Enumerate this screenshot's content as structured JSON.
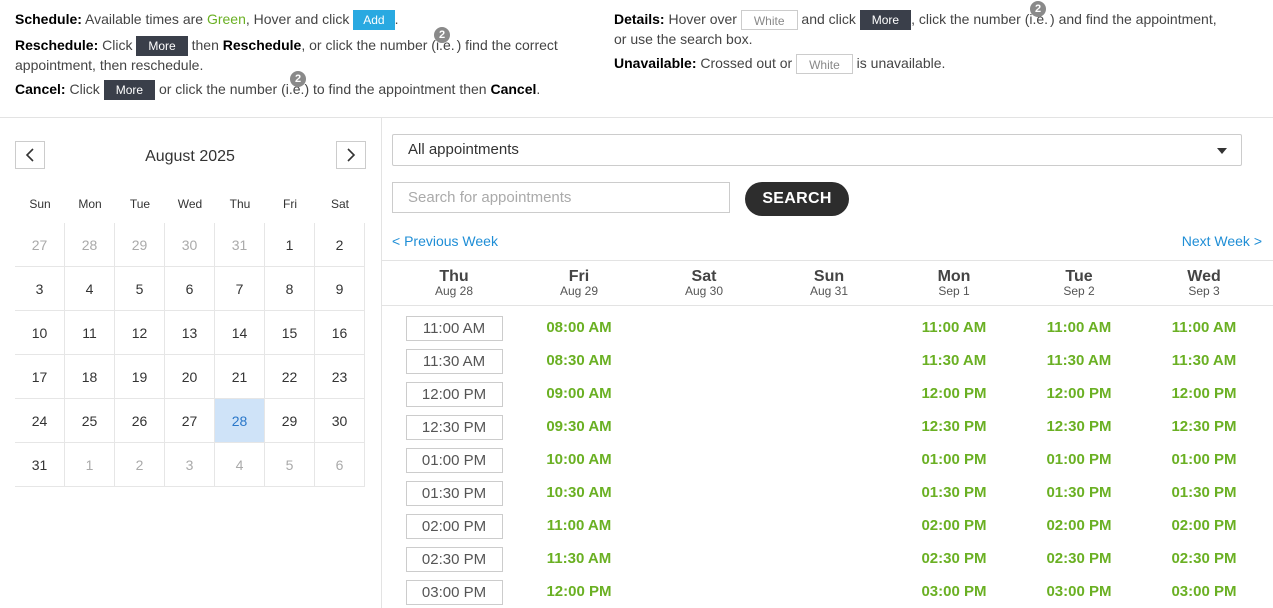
{
  "instructions": {
    "schedule": {
      "label": "Schedule:",
      "t1": "Available times are",
      "green": "Green",
      "t2": ", Hover and click",
      "add": "Add",
      "t3": "."
    },
    "reschedule": {
      "label": "Reschedule:",
      "t1": "Click",
      "more": "More",
      "t2": "then",
      "bold": "Reschedule",
      "t3": ", or click the number (i.e.",
      "badge": "2",
      "t4": ") find the correct",
      "t5": "appointment, then reschedule."
    },
    "cancel": {
      "label": "Cancel:",
      "t1": "Click",
      "more": "More",
      "t2": "or click the number (i.e.",
      "badge": "2",
      "t3": ") to find the appointment then",
      "bold": "Cancel",
      "t4": "."
    },
    "details": {
      "label": "Details:",
      "t1": "Hover over",
      "white": "White",
      "t2": "and click",
      "more": "More",
      "t3": ", click the number (i.e.",
      "badge": "2",
      "t4": ") and find the appointment,",
      "t5": "or use the search box."
    },
    "unavailable": {
      "label": "Unavailable:",
      "t1": "Crossed out or",
      "white": "White",
      "t2": "is unavailable."
    }
  },
  "calendar": {
    "month": "August 2025",
    "dow": [
      "Sun",
      "Mon",
      "Tue",
      "Wed",
      "Thu",
      "Fri",
      "Sat"
    ],
    "weeks": [
      [
        {
          "d": "27",
          "o": true
        },
        {
          "d": "28",
          "o": true
        },
        {
          "d": "29",
          "o": true
        },
        {
          "d": "30",
          "o": true
        },
        {
          "d": "31",
          "o": true
        },
        {
          "d": "1"
        },
        {
          "d": "2"
        }
      ],
      [
        {
          "d": "3"
        },
        {
          "d": "4"
        },
        {
          "d": "5"
        },
        {
          "d": "6"
        },
        {
          "d": "7"
        },
        {
          "d": "8"
        },
        {
          "d": "9"
        }
      ],
      [
        {
          "d": "10"
        },
        {
          "d": "11"
        },
        {
          "d": "12"
        },
        {
          "d": "13"
        },
        {
          "d": "14"
        },
        {
          "d": "15"
        },
        {
          "d": "16"
        }
      ],
      [
        {
          "d": "17"
        },
        {
          "d": "18"
        },
        {
          "d": "19"
        },
        {
          "d": "20"
        },
        {
          "d": "21"
        },
        {
          "d": "22"
        },
        {
          "d": "23"
        }
      ],
      [
        {
          "d": "24"
        },
        {
          "d": "25"
        },
        {
          "d": "26"
        },
        {
          "d": "27"
        },
        {
          "d": "28",
          "sel": true
        },
        {
          "d": "29"
        },
        {
          "d": "30"
        }
      ],
      [
        {
          "d": "31"
        },
        {
          "d": "1",
          "o": true
        },
        {
          "d": "2",
          "o": true
        },
        {
          "d": "3",
          "o": true
        },
        {
          "d": "4",
          "o": true
        },
        {
          "d": "5",
          "o": true
        },
        {
          "d": "6",
          "o": true
        }
      ]
    ]
  },
  "filter": {
    "selected": "All appointments"
  },
  "search": {
    "placeholder": "Search for appointments",
    "button": "SEARCH"
  },
  "nav": {
    "prev": "< Previous Week",
    "next": "Next Week >"
  },
  "days": [
    {
      "name": "Thu",
      "date": "Aug 28",
      "unavailable": true,
      "slots": [
        "11:00 AM",
        "11:30 AM",
        "12:00 PM",
        "12:30 PM",
        "01:00 PM",
        "01:30 PM",
        "02:00 PM",
        "02:30 PM",
        "03:00 PM"
      ]
    },
    {
      "name": "Fri",
      "date": "Aug 29",
      "slots": [
        "08:00 AM",
        "08:30 AM",
        "09:00 AM",
        "09:30 AM",
        "10:00 AM",
        "10:30 AM",
        "11:00 AM",
        "11:30 AM",
        "12:00 PM"
      ]
    },
    {
      "name": "Sat",
      "date": "Aug 30",
      "slots": []
    },
    {
      "name": "Sun",
      "date": "Aug 31",
      "slots": []
    },
    {
      "name": "Mon",
      "date": "Sep 1",
      "slots": [
        "11:00 AM",
        "11:30 AM",
        "12:00 PM",
        "12:30 PM",
        "01:00 PM",
        "01:30 PM",
        "02:00 PM",
        "02:30 PM",
        "03:00 PM"
      ]
    },
    {
      "name": "Tue",
      "date": "Sep 2",
      "slots": [
        "11:00 AM",
        "11:30 AM",
        "12:00 PM",
        "12:30 PM",
        "01:00 PM",
        "01:30 PM",
        "02:00 PM",
        "02:30 PM",
        "03:00 PM"
      ]
    },
    {
      "name": "Wed",
      "date": "Sep 3",
      "slots": [
        "11:00 AM",
        "11:30 AM",
        "12:00 PM",
        "12:30 PM",
        "01:00 PM",
        "01:30 PM",
        "02:00 PM",
        "02:30 PM",
        "03:00 PM"
      ]
    }
  ],
  "colors": {
    "available": "#6ab023",
    "add": "#29a9e1",
    "more": "#3a3f4a",
    "selectedDay": "#cfe3f8",
    "link": "#1f8ed6"
  }
}
